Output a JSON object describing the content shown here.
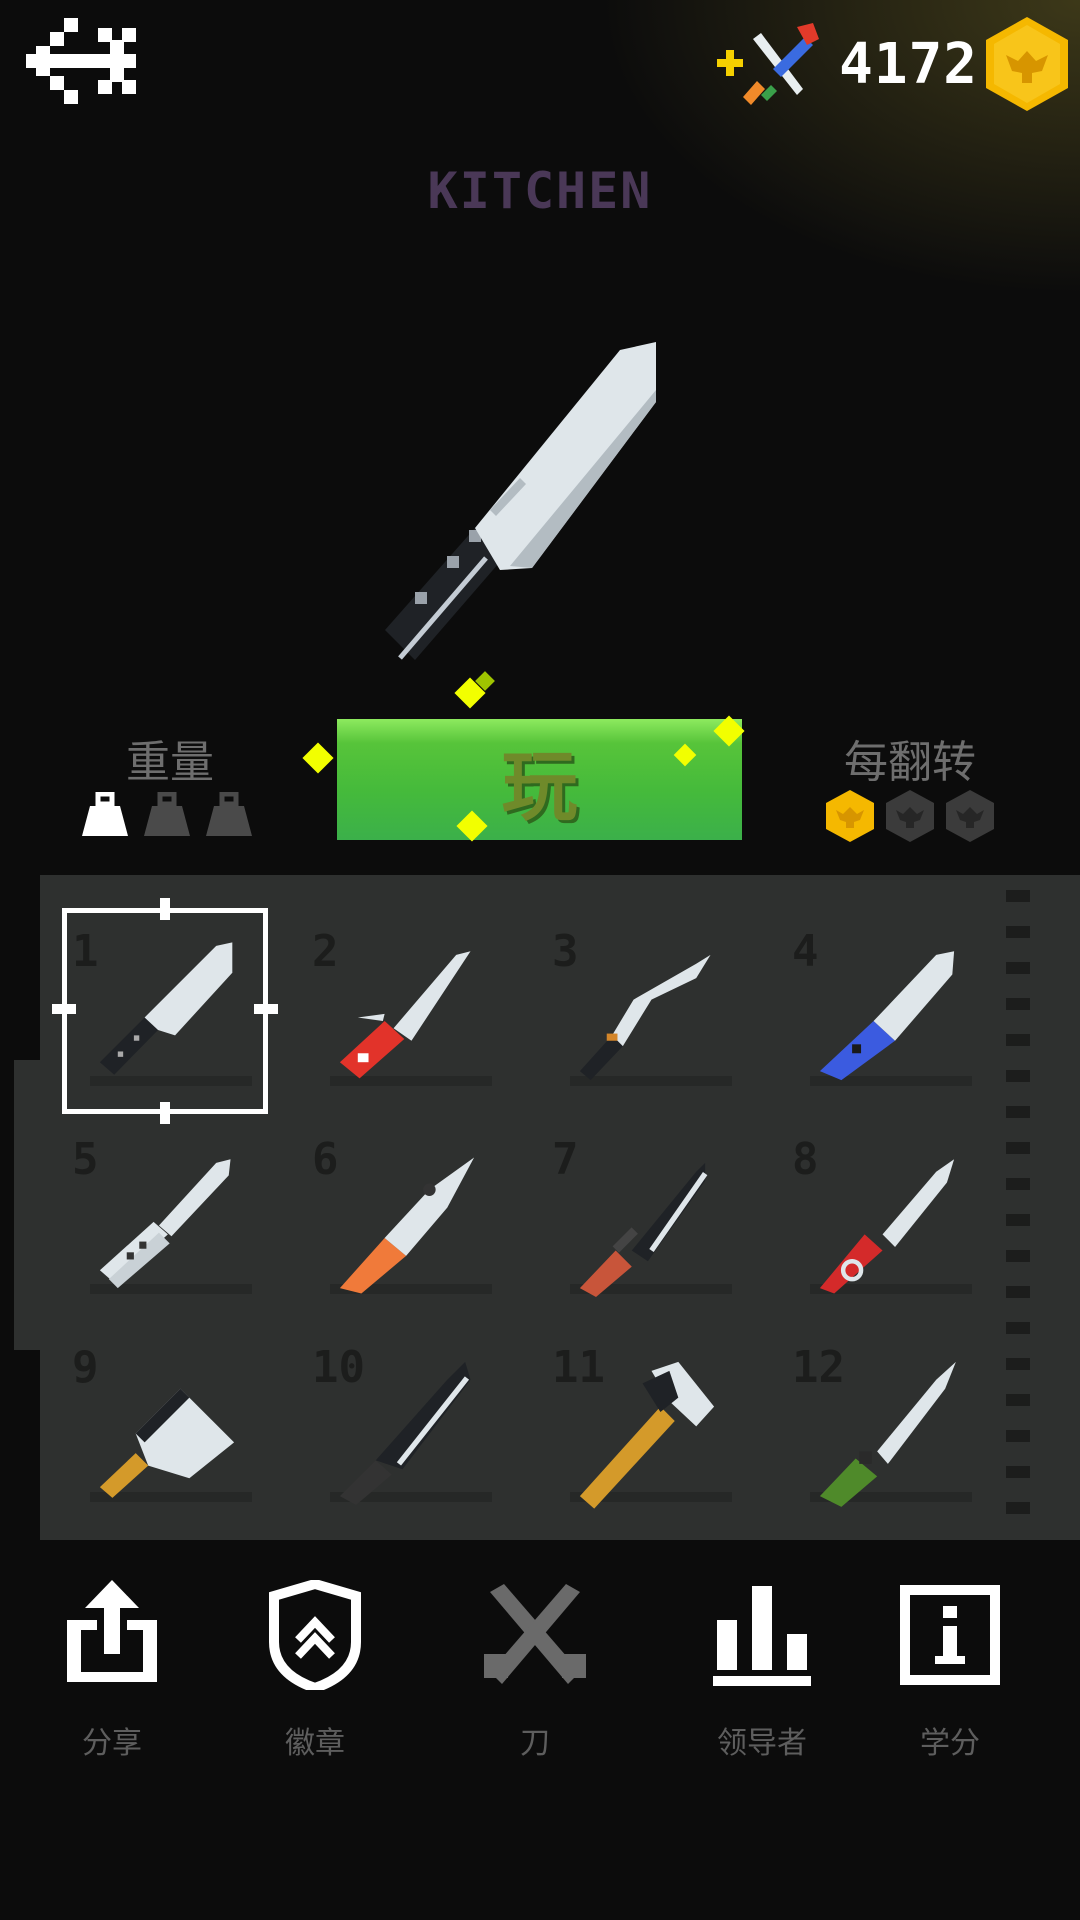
{
  "header": {
    "coins": "4172",
    "knife_name": "KITCHEN"
  },
  "stats": {
    "weight_label": "重量",
    "weight_level": 1,
    "weight_max": 3,
    "flip_label": "每翻转",
    "flip_reward": 1,
    "flip_max": 3
  },
  "play": {
    "label": "玩"
  },
  "grid": {
    "selected": 1,
    "slots": [
      {
        "num": "1",
        "icon": "kitchen-knife-icon"
      },
      {
        "num": "2",
        "icon": "swiss-army-knife-icon"
      },
      {
        "num": "3",
        "icon": "kukri-icon"
      },
      {
        "num": "4",
        "icon": "blue-folding-knife-icon"
      },
      {
        "num": "5",
        "icon": "butterfly-knife-icon"
      },
      {
        "num": "6",
        "icon": "orange-pocket-knife-icon"
      },
      {
        "num": "7",
        "icon": "combat-knife-icon"
      },
      {
        "num": "8",
        "icon": "karambit-icon"
      },
      {
        "num": "9",
        "icon": "cleaver-icon"
      },
      {
        "num": "10",
        "icon": "machete-icon"
      },
      {
        "num": "11",
        "icon": "hatchet-icon"
      },
      {
        "num": "12",
        "icon": "dagger-icon"
      }
    ]
  },
  "nav": [
    {
      "label": "分享",
      "icon": "share-icon"
    },
    {
      "label": "徽章",
      "icon": "badge-icon"
    },
    {
      "label": "刀",
      "icon": "knives-icon"
    },
    {
      "label": "领导者",
      "icon": "leaderboard-icon"
    },
    {
      "label": "学分",
      "icon": "info-icon"
    }
  ],
  "colors": {
    "play_green": "#45ba3b",
    "coin_gold": "#f5b800",
    "panel": "#2e302f",
    "title_purple": "#4a3857"
  }
}
